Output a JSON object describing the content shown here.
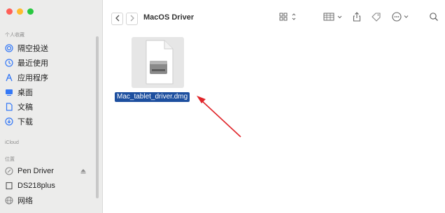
{
  "window": {
    "title": "MacOS Driver"
  },
  "sidebar": {
    "favorites_title": "个人收藏",
    "favorites": [
      {
        "label": "隔空投送",
        "icon": "airdrop-icon"
      },
      {
        "label": "最近使用",
        "icon": "clock-icon"
      },
      {
        "label": "应用程序",
        "icon": "applications-icon"
      },
      {
        "label": "桌面",
        "icon": "desktop-icon"
      },
      {
        "label": "文稿",
        "icon": "document-icon"
      },
      {
        "label": "下载",
        "icon": "download-icon"
      }
    ],
    "icloud_title": "iCloud",
    "locations_title": "位置",
    "locations": [
      {
        "label": "Pen Driver",
        "icon": "disk-icon",
        "eject": true
      },
      {
        "label": "DS218plus",
        "icon": "server-icon"
      },
      {
        "label": "网络",
        "icon": "network-icon"
      }
    ]
  },
  "files": [
    {
      "name": "Mac_tablet_driver.dmg",
      "icon": "disk-image-icon",
      "selected": true
    }
  ],
  "colors": {
    "selection": "#1d4f9f",
    "annotation_arrow": "#e0252a"
  }
}
